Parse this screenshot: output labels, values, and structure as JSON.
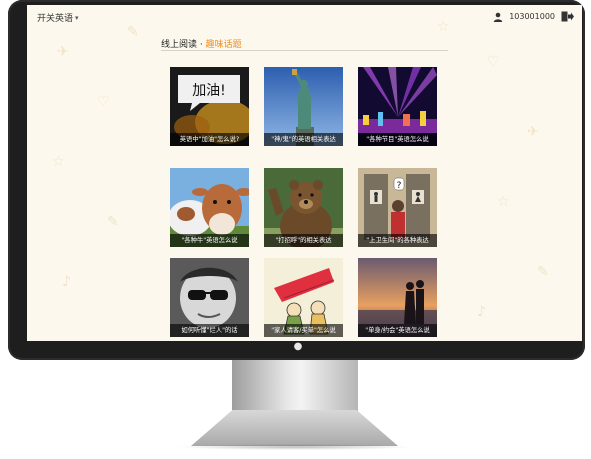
{
  "app": {
    "menu_label": "开关英语"
  },
  "user": {
    "id": "103001000"
  },
  "section": {
    "prefix": "线上阅读 · ",
    "highlight": "趣味话题"
  },
  "topics": [
    {
      "caption": "英语中\"加油\"怎么说?",
      "image_text": "加油!"
    },
    {
      "caption": "\"神/鬼\"的英语相关表达"
    },
    {
      "caption": "\"各种节目\"英语怎么说"
    },
    {
      "caption": "\"各种牛\"英语怎么说"
    },
    {
      "caption": "\"打招呼\"的相关表达"
    },
    {
      "caption": "\"上卫生间\"的各种表达"
    },
    {
      "caption": "如何听懂\"烂人\"的话"
    },
    {
      "caption": "\"家人请客/买单\"怎么说"
    },
    {
      "caption": "\"单身/约会\"英语怎么说"
    }
  ],
  "colors": {
    "accent": "#f08c1a",
    "screen_bg": "#fdf8ee",
    "bezel": "#1e1e1e"
  }
}
